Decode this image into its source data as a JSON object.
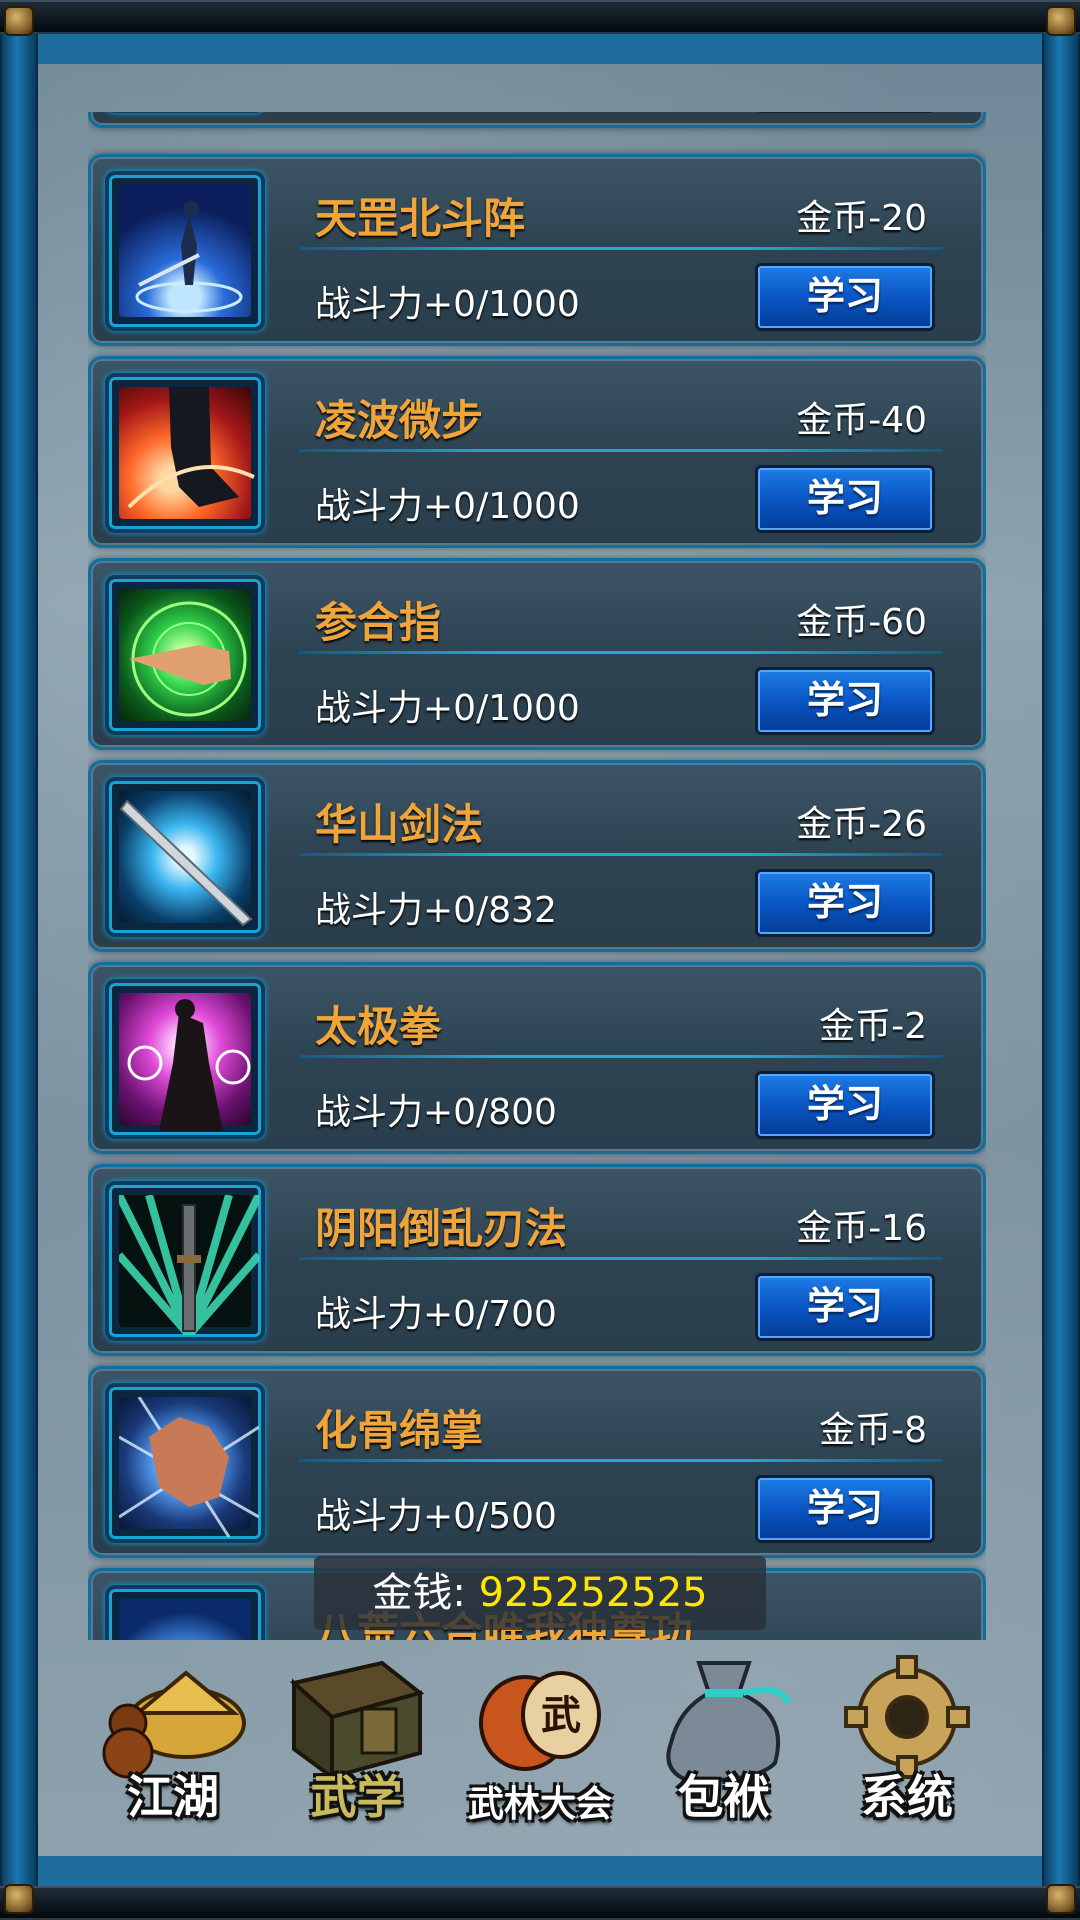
{
  "skills": [
    {
      "name": "天罡北斗阵",
      "cost": "金币-20",
      "power": "战斗力+0/1000",
      "button": "学习"
    },
    {
      "name": "凌波微步",
      "cost": "金币-40",
      "power": "战斗力+0/1000",
      "button": "学习"
    },
    {
      "name": "参合指",
      "cost": "金币-60",
      "power": "战斗力+0/1000",
      "button": "学习"
    },
    {
      "name": "华山剑法",
      "cost": "金币-26",
      "power": "战斗力+0/832",
      "button": "学习"
    },
    {
      "name": "太极拳",
      "cost": "金币-2",
      "power": "战斗力+0/800",
      "button": "学习"
    },
    {
      "name": "阴阳倒乱刃法",
      "cost": "金币-16",
      "power": "战斗力+0/700",
      "button": "学习"
    },
    {
      "name": "化骨绵掌",
      "cost": "金币-8",
      "power": "战斗力+0/500",
      "button": "学习"
    },
    {
      "name": "八荒六合唯我独尊功",
      "cost": "",
      "power": "",
      "button": ""
    }
  ],
  "money": {
    "label": "金钱:",
    "value": "925252525"
  },
  "nav": [
    {
      "label": "江湖",
      "icon": "hat-gourd-icon"
    },
    {
      "label": "武学",
      "icon": "book-icon"
    },
    {
      "label": "武林大会",
      "icon": "drum-icon"
    },
    {
      "label": "包袱",
      "icon": "bag-icon"
    },
    {
      "label": "系统",
      "icon": "gear-icon"
    }
  ],
  "colors": {
    "accent": "#f0a53a",
    "money": "#ffe600",
    "button": "#0a56c4",
    "frame": "#0f6f9d"
  }
}
